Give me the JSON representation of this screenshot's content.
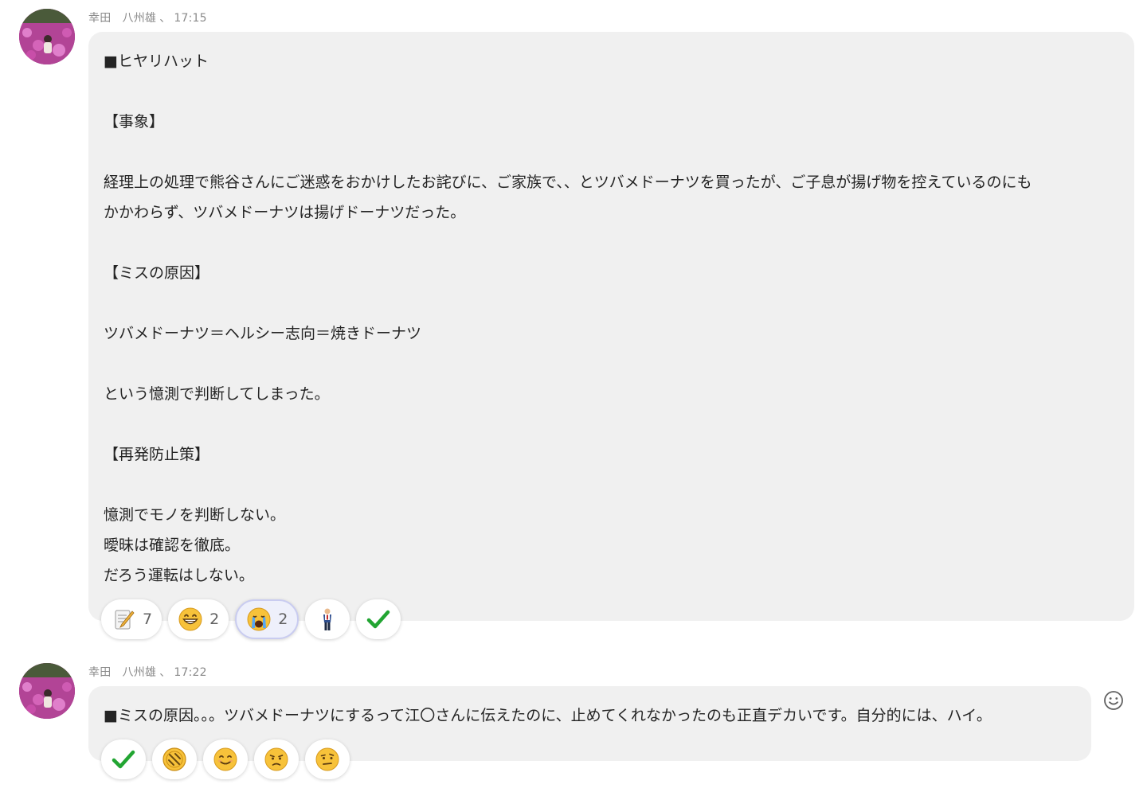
{
  "messages": [
    {
      "author": "幸田　八州雄",
      "time": "17:15",
      "lines": [
        "■ヒヤリハット",
        "",
        "【事象】",
        "",
        "経理上の処理で熊谷さんにご迷惑をおかけしたお詫びに、ご家族で、、とツバメドーナツを買ったが、ご子息が揚げ物を控えているのにも",
        "かかわらず、ツバメドーナツは揚げドーナツだった。",
        "",
        "【ミスの原因】",
        "",
        "ツバメドーナツ＝ヘルシー志向＝焼きドーナツ",
        "",
        "という憶測で判断してしまった。",
        "",
        "【再発防止策】",
        "",
        "憶測でモノを判断しない。",
        "曖昧は確認を徹底。",
        "だろう運転はしない。"
      ],
      "reactions": [
        {
          "icon": "memo-icon",
          "count": "7"
        },
        {
          "icon": "grinning-face-icon",
          "count": "2"
        },
        {
          "icon": "crying-face-icon",
          "count": "2",
          "selected": true
        },
        {
          "icon": "person-standing-icon"
        },
        {
          "icon": "check-mark-icon"
        }
      ]
    },
    {
      "author": "幸田　八州雄",
      "time": "17:22",
      "lines": [
        "■ミスの原因。。。ツバメドーナツにするって江〇さんに伝えたのに、止めてくれなかったのも正直デカいです。自分的には、ハイ。"
      ],
      "reactions": [
        {
          "icon": "check-mark-icon"
        },
        {
          "icon": "coin-icon"
        },
        {
          "icon": "smiling-face-icon"
        },
        {
          "icon": "sad-face-icon"
        },
        {
          "icon": "skeptical-face-icon"
        }
      ]
    }
  ],
  "meta_separator": "、",
  "add_reaction_icon": "smiley-outline-icon"
}
